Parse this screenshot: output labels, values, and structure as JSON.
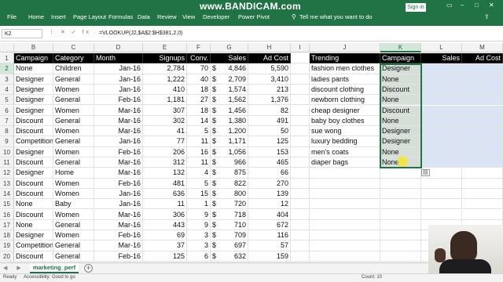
{
  "ribbon": {
    "tabs": [
      "File",
      "Home",
      "Insert",
      "Page Layout",
      "Formulas",
      "Data",
      "Review",
      "View",
      "Developer",
      "Power Pivot"
    ],
    "tell_me": "Tell me what you want to do",
    "sign_in": "Sign in",
    "share": "Share"
  },
  "watermark": "www.BANDICAM.com",
  "formula_bar": {
    "name_box": "K2",
    "formula": "=VLOOKUP(J2,$A$2:$H$381,2,0)"
  },
  "columns": [
    "B",
    "C",
    "D",
    "E",
    "F",
    "G",
    "H",
    "I",
    "J",
    "K",
    "L",
    "M"
  ],
  "selected_column": "K",
  "selected_row": 2,
  "rows": [
    1,
    2,
    3,
    4,
    5,
    6,
    7,
    8,
    9,
    10,
    11,
    12,
    13,
    14,
    15,
    16,
    17,
    18,
    19,
    20
  ],
  "left_headers": [
    "Campaign",
    "Category",
    "Month",
    "Signups",
    "Conv.",
    "Sales",
    "Ad Cost"
  ],
  "left_data": [
    [
      "None",
      "Children",
      "Jan-16",
      "2,784",
      "70",
      "$",
      "4,846",
      "5,590"
    ],
    [
      "Designer",
      "General",
      "Jan-16",
      "1,222",
      "40",
      "$",
      "2,709",
      "3,410"
    ],
    [
      "Designer",
      "Women",
      "Jan-16",
      "410",
      "18",
      "$",
      "1,574",
      "213"
    ],
    [
      "Designer",
      "General",
      "Feb-16",
      "1,181",
      "27",
      "$",
      "1,562",
      "1,376"
    ],
    [
      "Designer",
      "Women",
      "Mar-16",
      "307",
      "18",
      "$",
      "1,456",
      "82"
    ],
    [
      "Discount",
      "General",
      "Mar-16",
      "302",
      "14",
      "$",
      "1,380",
      "491"
    ],
    [
      "Discount",
      "Women",
      "Mar-16",
      "41",
      "5",
      "$",
      "1,200",
      "50"
    ],
    [
      "Competition",
      "General",
      "Jan-16",
      "77",
      "11",
      "$",
      "1,171",
      "125"
    ],
    [
      "Designer",
      "Women",
      "Feb-16",
      "206",
      "16",
      "$",
      "1,056",
      "153"
    ],
    [
      "Discount",
      "General",
      "Mar-16",
      "312",
      "11",
      "$",
      "966",
      "465"
    ],
    [
      "Designer",
      "Home",
      "Mar-16",
      "132",
      "4",
      "$",
      "875",
      "66"
    ],
    [
      "Discount",
      "Women",
      "Feb-16",
      "481",
      "5",
      "$",
      "822",
      "270"
    ],
    [
      "Discount",
      "Women",
      "Jan-16",
      "636",
      "15",
      "$",
      "800",
      "139"
    ],
    [
      "None",
      "Baby",
      "Jan-16",
      "11",
      "1",
      "$",
      "720",
      "12"
    ],
    [
      "Discount",
      "Women",
      "Mar-16",
      "306",
      "9",
      "$",
      "718",
      "404"
    ],
    [
      "None",
      "General",
      "Mar-16",
      "443",
      "9",
      "$",
      "710",
      "672"
    ],
    [
      "Designer",
      "Women",
      "Feb-16",
      "69",
      "3",
      "$",
      "709",
      "116"
    ],
    [
      "Competition",
      "General",
      "Mar-16",
      "37",
      "3",
      "$",
      "697",
      "57"
    ],
    [
      "Discount",
      "General",
      "Feb-16",
      "125",
      "6",
      "$",
      "632",
      "159"
    ]
  ],
  "right_headers": [
    "Trending",
    "Campaign",
    "Sales",
    "Ad Cost"
  ],
  "right_data": [
    [
      "fashion men clothes",
      "Designer"
    ],
    [
      "ladies pants",
      "None"
    ],
    [
      "discount clothing",
      "Discount"
    ],
    [
      "newborn clothing",
      "None"
    ],
    [
      "cheap designer",
      "Discount"
    ],
    [
      "baby boy clothes",
      "None"
    ],
    [
      "sue wong",
      "Designer"
    ],
    [
      "luxury bedding",
      "Designer"
    ],
    [
      "men's coats",
      "None"
    ],
    [
      "diaper bags",
      "None"
    ]
  ],
  "sheet_tab": "marketing_perf",
  "status": {
    "ready": "Ready",
    "accessibility": "Accessibility: Good to go",
    "count": "Count: 10"
  }
}
